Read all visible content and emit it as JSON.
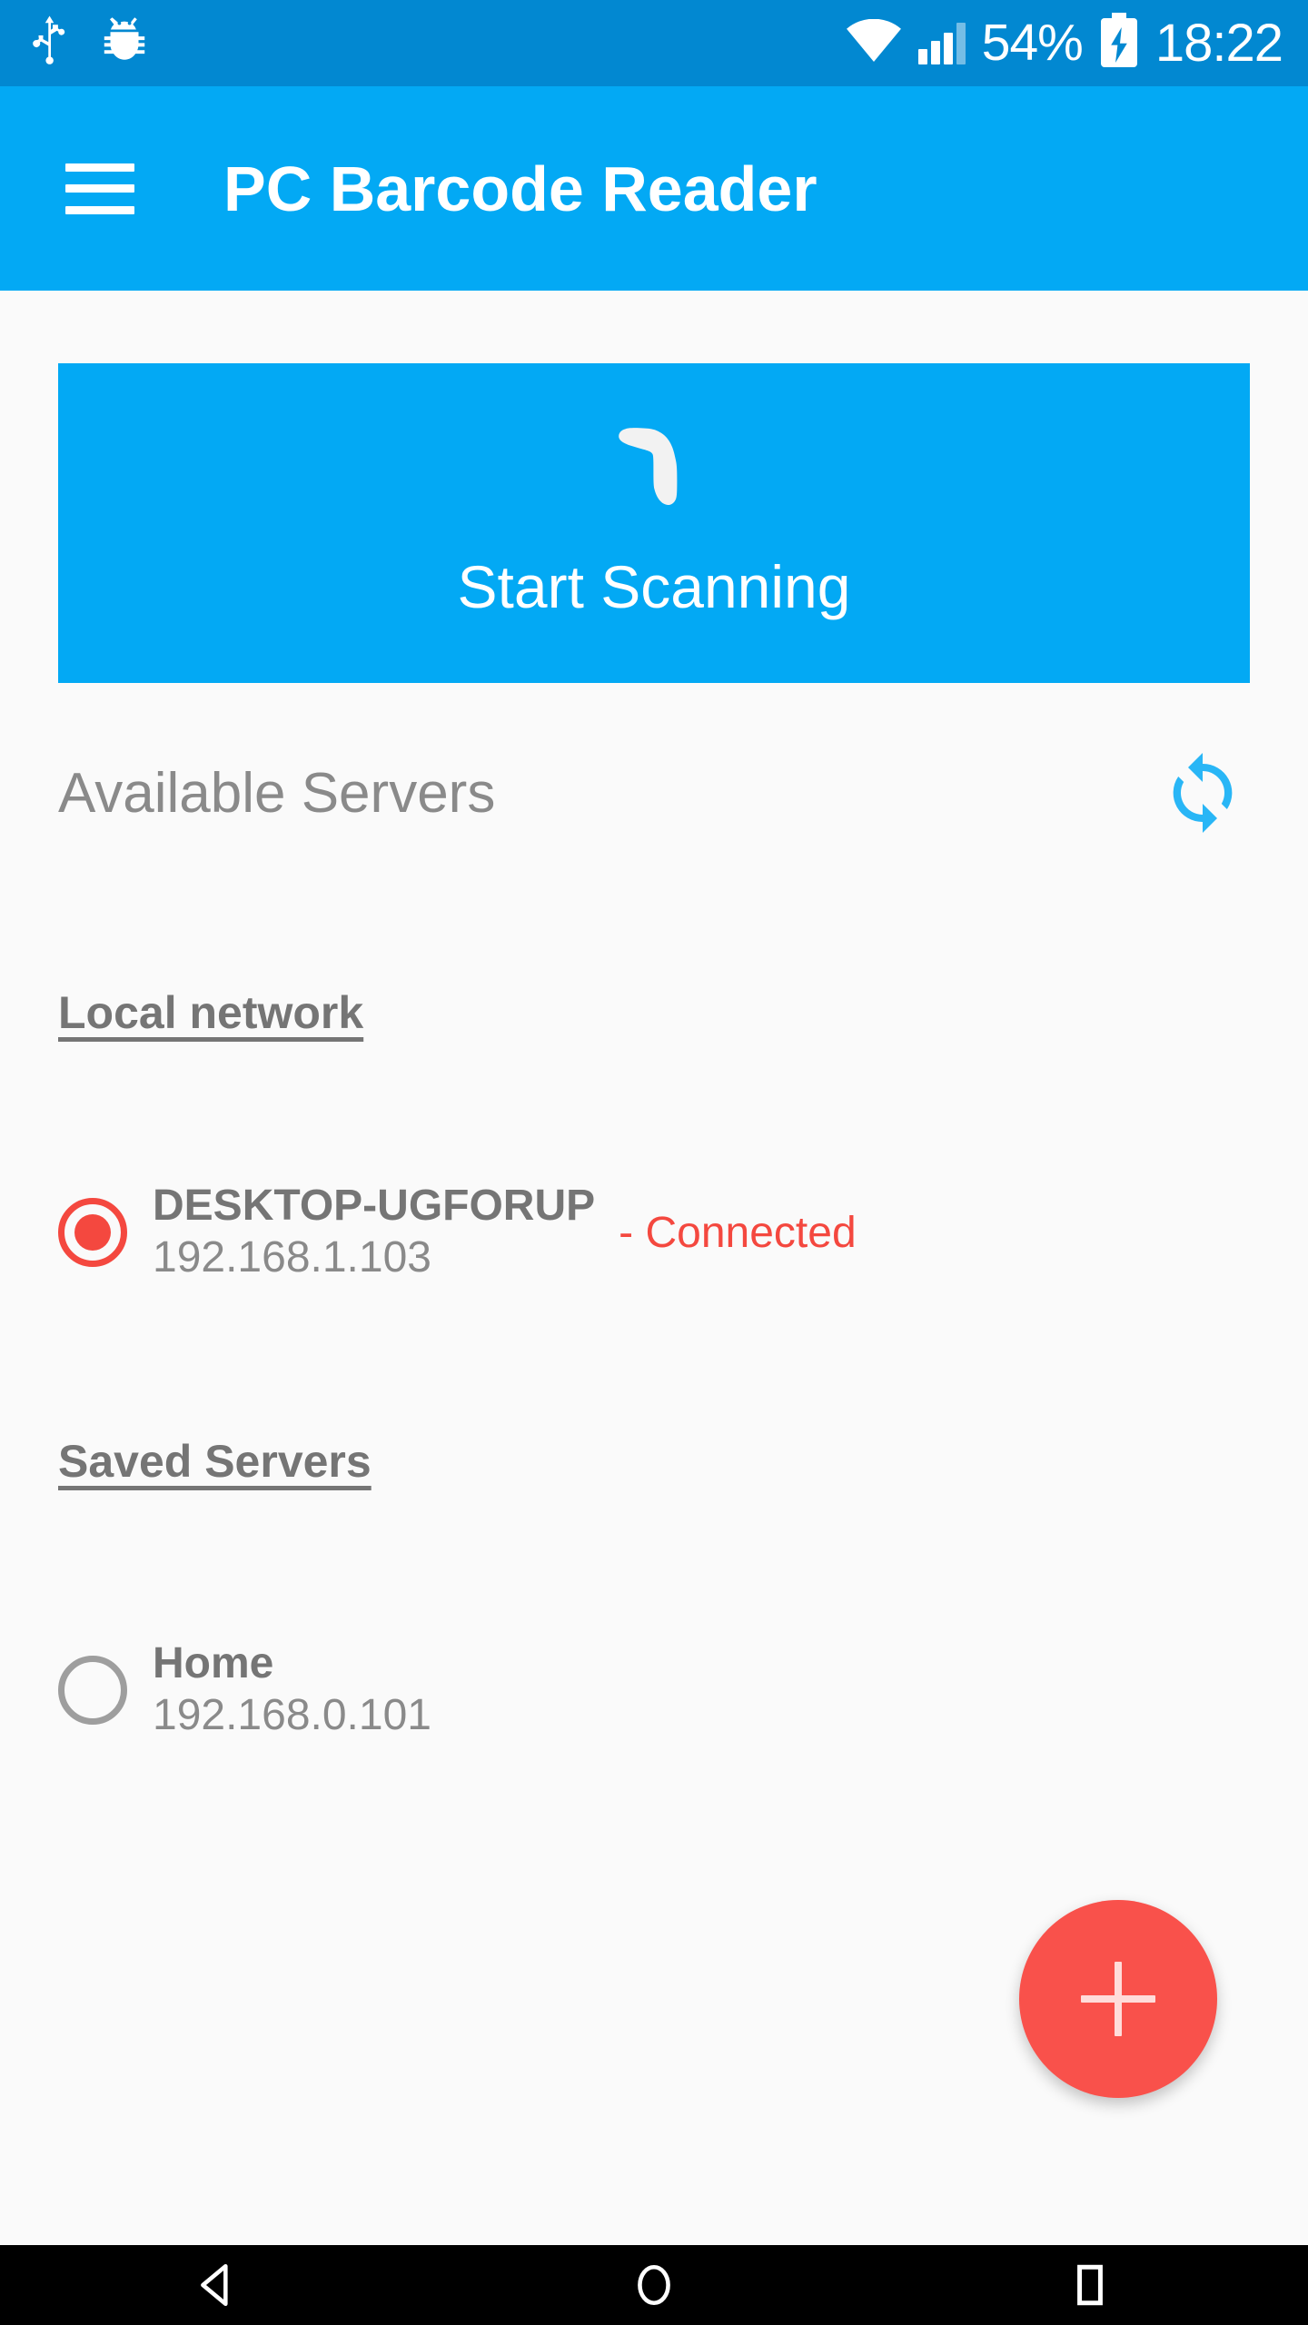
{
  "status_bar": {
    "icons": [
      "usb-icon",
      "bug-icon",
      "wifi-icon",
      "signal-icon",
      "battery-charging-icon"
    ],
    "battery_percent": "54%",
    "clock": "18:22",
    "background_color": "#0288D1"
  },
  "app_bar": {
    "menu_icon": "hamburger-menu-icon",
    "title": "PC Barcode Reader",
    "background_color": "#03A9F4"
  },
  "scan_button": {
    "icon": "barcode-scanner-icon",
    "label": "Start Scanning",
    "background_color": "#03A9F4"
  },
  "servers_section": {
    "title": "Available Servers",
    "refresh_icon": "refresh-icon",
    "refresh_color": "#29B6F6"
  },
  "groups": [
    {
      "label": "Local network",
      "servers": [
        {
          "name": "DESKTOP-UGFORUP",
          "ip": "192.168.1.103",
          "status": "- Connected",
          "selected": true
        }
      ]
    },
    {
      "label": "Saved Servers",
      "servers": [
        {
          "name": "Home",
          "ip": "192.168.0.101",
          "status": "",
          "selected": false
        }
      ]
    }
  ],
  "fab": {
    "icon": "plus-icon",
    "color": "#F9514B"
  },
  "nav_bar": {
    "back": "back-triangle-icon",
    "home": "home-circle-icon",
    "recents": "recents-square-icon"
  },
  "colors": {
    "accent": "#03A9F4",
    "status_bar": "#0288D1",
    "background": "#FAFAFA",
    "connected": "#F4483F",
    "text_gray": "#757575"
  }
}
